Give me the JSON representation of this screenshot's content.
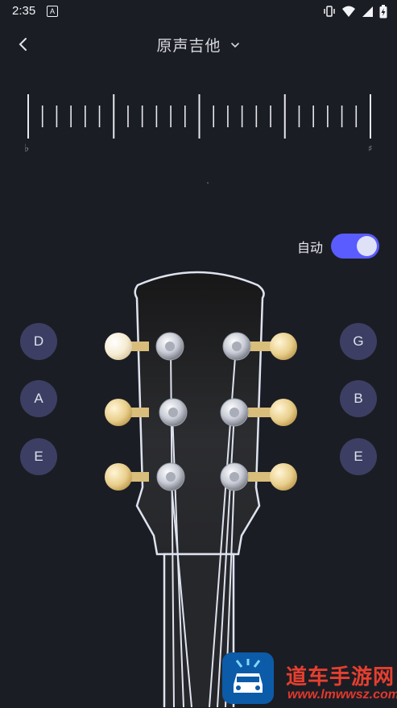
{
  "status_bar": {
    "time": "2:35",
    "app_icon": "A",
    "icons": [
      "vibrate-icon",
      "wifi-icon",
      "signal-icon",
      "battery-charging-icon"
    ]
  },
  "header": {
    "back_icon": "chevron-left-icon",
    "title": "原声吉他",
    "dropdown_icon": "chevron-down-icon"
  },
  "tuner": {
    "flat_symbol": "♭",
    "sharp_symbol": "♯"
  },
  "auto_mode": {
    "label": "自动",
    "enabled": true,
    "accent_color": "#5a5cff"
  },
  "strings": {
    "left": [
      "D",
      "A",
      "E"
    ],
    "right": [
      "G",
      "B",
      "E"
    ],
    "button_color": "#3c3f63"
  },
  "watermark": {
    "name": "道车手游网",
    "url": "www.lmwwsz.com"
  }
}
